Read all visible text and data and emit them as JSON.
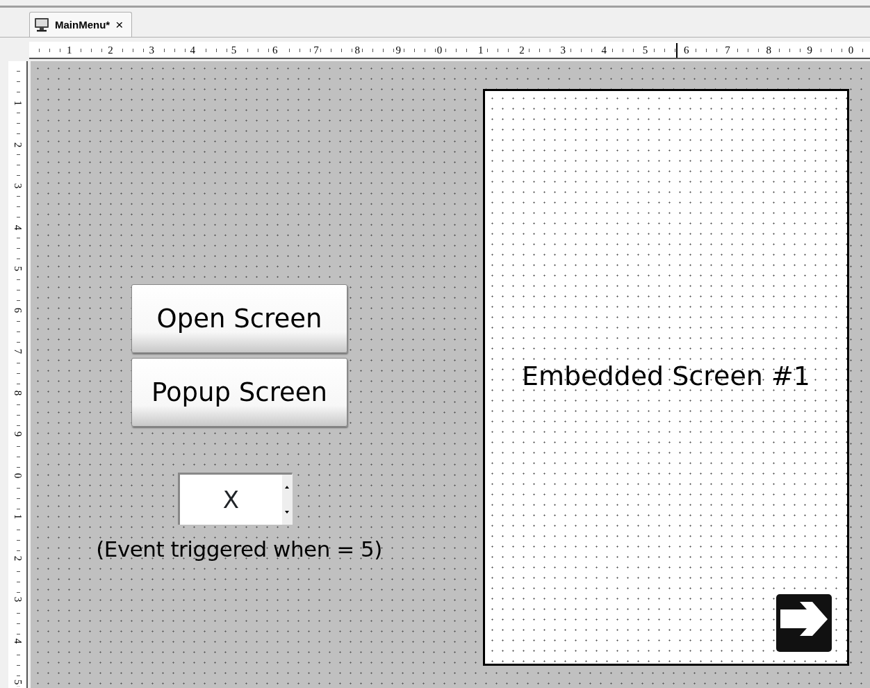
{
  "tabs": [
    {
      "label": "MainMenu*",
      "close": "×",
      "selected": true
    }
  ],
  "rulers": {
    "horizontal": [
      "1",
      "2",
      "3",
      "4",
      "5",
      "6",
      "7",
      "8",
      "9",
      "0",
      "1",
      "2",
      "3",
      "4",
      "5",
      "6",
      "7",
      "8",
      "9",
      "0"
    ],
    "vertical": [
      "1",
      "2",
      "3",
      "4",
      "5",
      "6",
      "7",
      "8",
      "9",
      "0",
      "1",
      "2",
      "3",
      "4",
      "5"
    ]
  },
  "canvas": {
    "buttons": [
      {
        "label": "Open Screen"
      },
      {
        "label": "Popup Screen"
      }
    ],
    "spinner": {
      "value": "X"
    },
    "caption": "(Event triggered when = 5)",
    "embedded_screen": {
      "title": "Embedded Screen #1"
    }
  }
}
